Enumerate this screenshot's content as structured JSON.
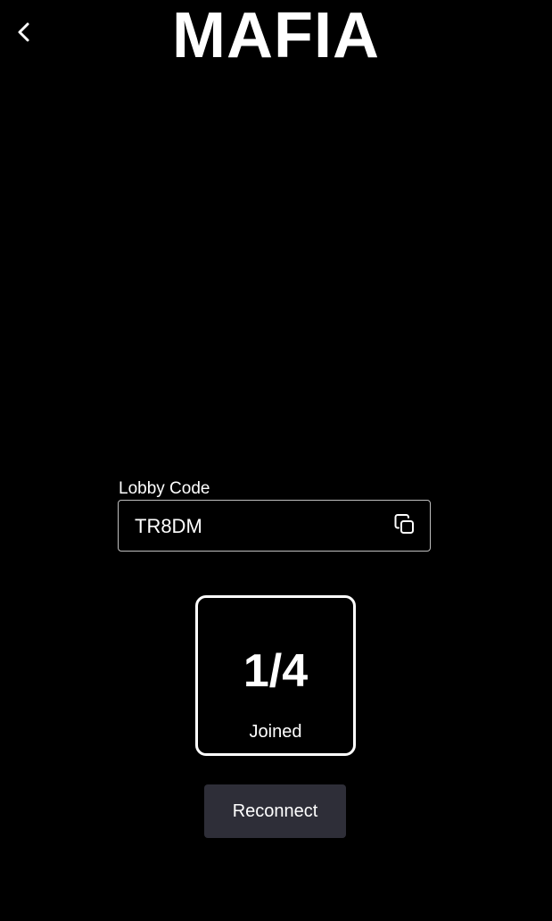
{
  "header": {
    "back_icon": "chevron-left-icon",
    "title": "MAFIA"
  },
  "lobby": {
    "label": "Lobby Code",
    "code": "TR8DM",
    "copy_icon": "copy-icon"
  },
  "players": {
    "count": "1/4",
    "label": "Joined"
  },
  "actions": {
    "reconnect_label": "Reconnect"
  },
  "colors": {
    "background": "#000000",
    "text": "#ffffff",
    "field_border": "#bfbfbf",
    "button_bg": "#2e2e38"
  }
}
